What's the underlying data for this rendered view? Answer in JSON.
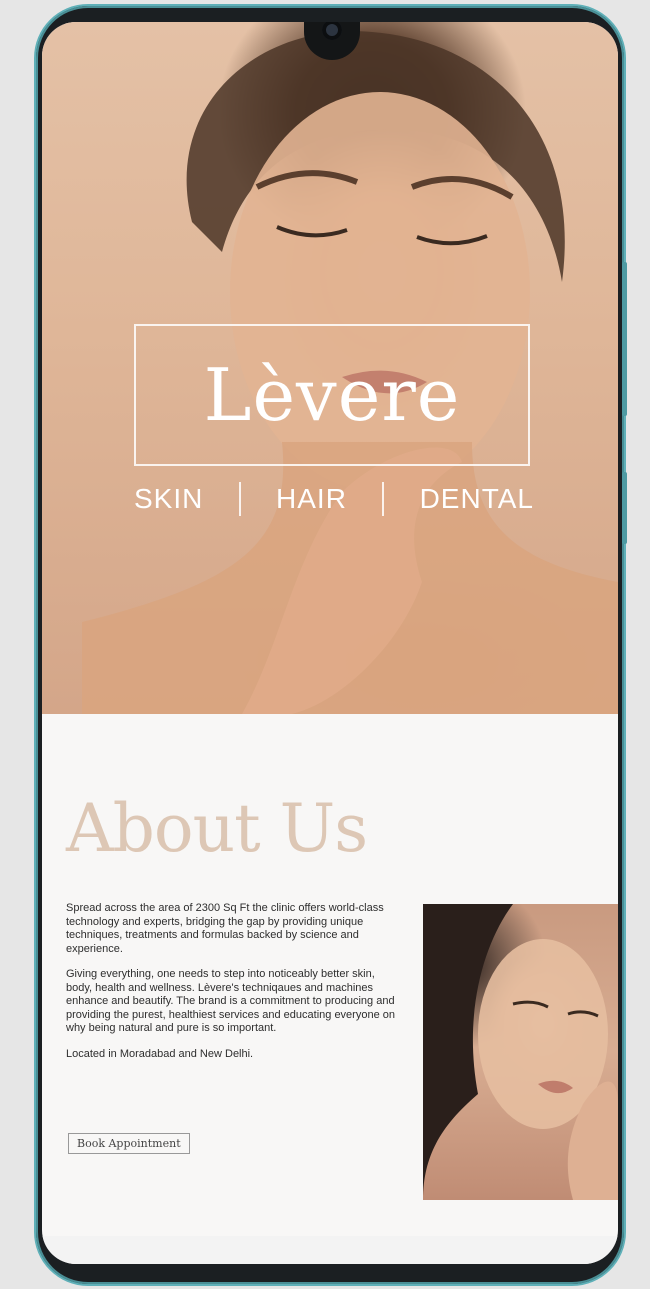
{
  "hero": {
    "brand": "Lèvere",
    "services": [
      "SKIN",
      "HAIR",
      "DENTAL"
    ]
  },
  "about": {
    "title": "About Us",
    "paragraphs": [
      "Spread across the area of 2300 Sq Ft the clinic offers world-class technology and experts, bridging the gap by providing unique techniques, treatments and formulas backed by science and experience.",
      "Giving everything, one needs to step into noticeably better skin, body, health and wellness. Lèvere's techniqaues and machines enhance and beautify. The brand is a commitment to producing and providing the purest, healthiest services and educating everyone on why being natural and pure is so important.",
      "Located in Moradabad and New Delhi."
    ],
    "cta": "Book Appointment"
  },
  "colors": {
    "accent": "#ddc7b5",
    "frame": "#5fb0b8",
    "skin": "#dfb698"
  },
  "icons": [
    "front-camera-icon"
  ]
}
